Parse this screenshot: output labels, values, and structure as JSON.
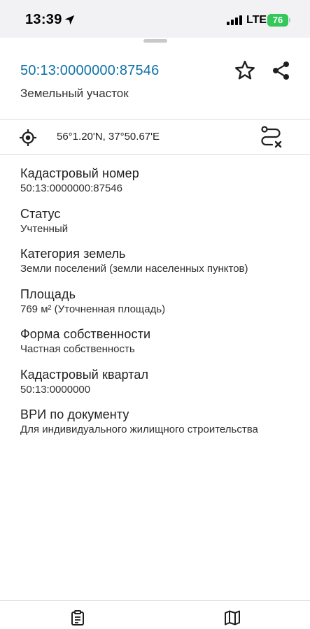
{
  "status_bar": {
    "time": "13:39",
    "network": "LTE",
    "battery": "76"
  },
  "header": {
    "cadastral_number": "50:13:0000000:87546",
    "subtitle": "Земельный участок"
  },
  "location": {
    "coordinates": "56°1.20'N, 37°50.67'E"
  },
  "fields": [
    {
      "label": "Кадастровый номер",
      "value": "50:13:0000000:87546"
    },
    {
      "label": "Статус",
      "value": "Учтенный"
    },
    {
      "label": "Категория земель",
      "value": "Земли поселений (земли населенных пунктов)"
    },
    {
      "label": "Площадь",
      "value": "769 м² (Уточненная площадь)"
    },
    {
      "label": "Форма собственности",
      "value": "Частная собственность"
    },
    {
      "label": "Кадастровый квартал",
      "value": "50:13:0000000"
    },
    {
      "label": "ВРИ по документу",
      "value": "Для индивидуального жилищного строительства"
    }
  ],
  "colors": {
    "accent": "#0f72a8",
    "battery": "#34c759"
  },
  "icons": {
    "favorite": "star-icon",
    "share": "share-icon",
    "locate": "target-icon",
    "route": "route-clear-icon",
    "info_tab": "clipboard-icon",
    "map_tab": "map-icon"
  }
}
